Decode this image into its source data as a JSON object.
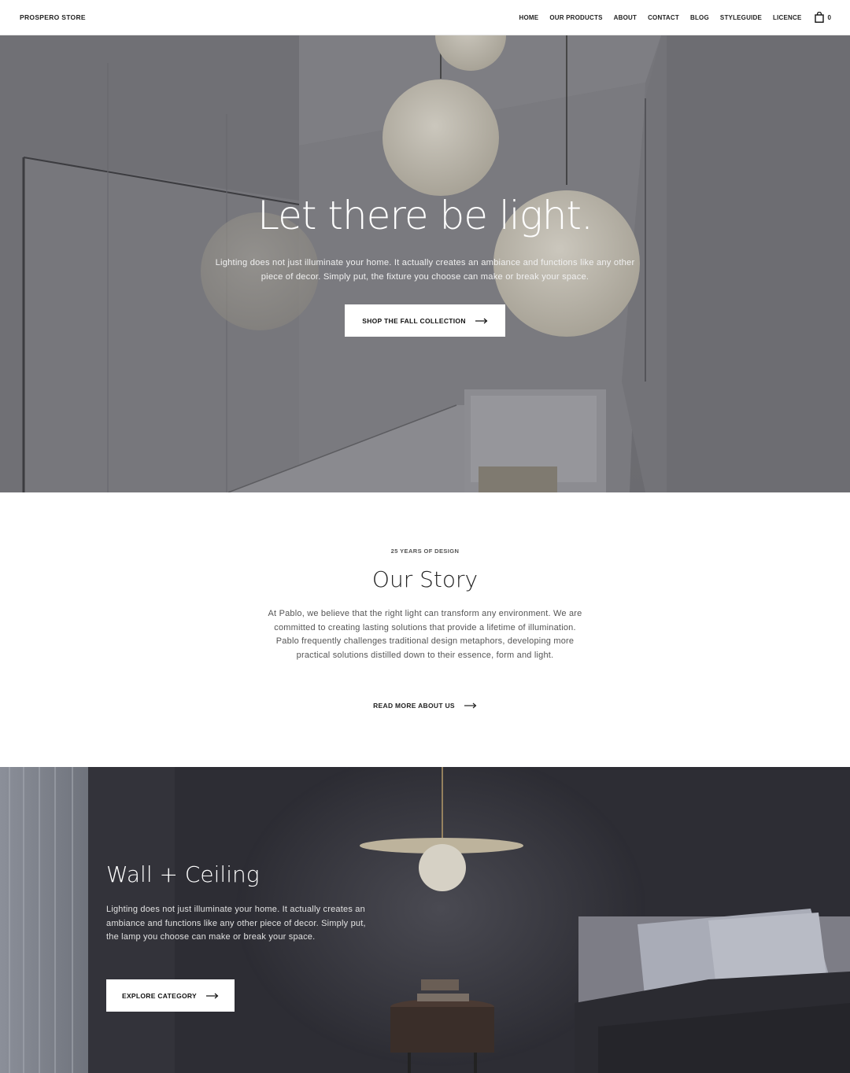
{
  "header": {
    "brand": "PROSPERO STORE",
    "nav": [
      "HOME",
      "OUR PRODUCTS",
      "ABOUT",
      "CONTACT",
      "BLOG",
      "STYLEGUIDE",
      "LICENCE"
    ],
    "cart_count": "0"
  },
  "hero": {
    "title": "Let there be light.",
    "text": "Lighting does not just illuminate your home. It actually creates an ambiance and functions like any other piece of decor. Simply put, the fixture you choose can make or break your space.",
    "button": "SHOP THE FALL COLLECTION"
  },
  "story": {
    "eyebrow": "25 YEARS OF DESIGN",
    "title": "Our Story",
    "text": "At Pablo, we believe that the right light can transform any environment. We are committed to creating lasting solutions that provide a lifetime of illumination. Pablo frequently challenges traditional design metaphors, developing more practical solutions distilled down to their essence, form and light.",
    "link": "READ MORE ABOUT US"
  },
  "category": {
    "title": "Wall + Ceiling",
    "text": "Lighting does not just illuminate your home. It actually creates an ambiance and functions like any other piece of decor. Simply put, the lamp you choose can make or break your space.",
    "button": "EXPLORE CATEGORY"
  },
  "icons": {
    "cart": "shopping-bag-icon",
    "arrow": "arrow-right-icon"
  }
}
